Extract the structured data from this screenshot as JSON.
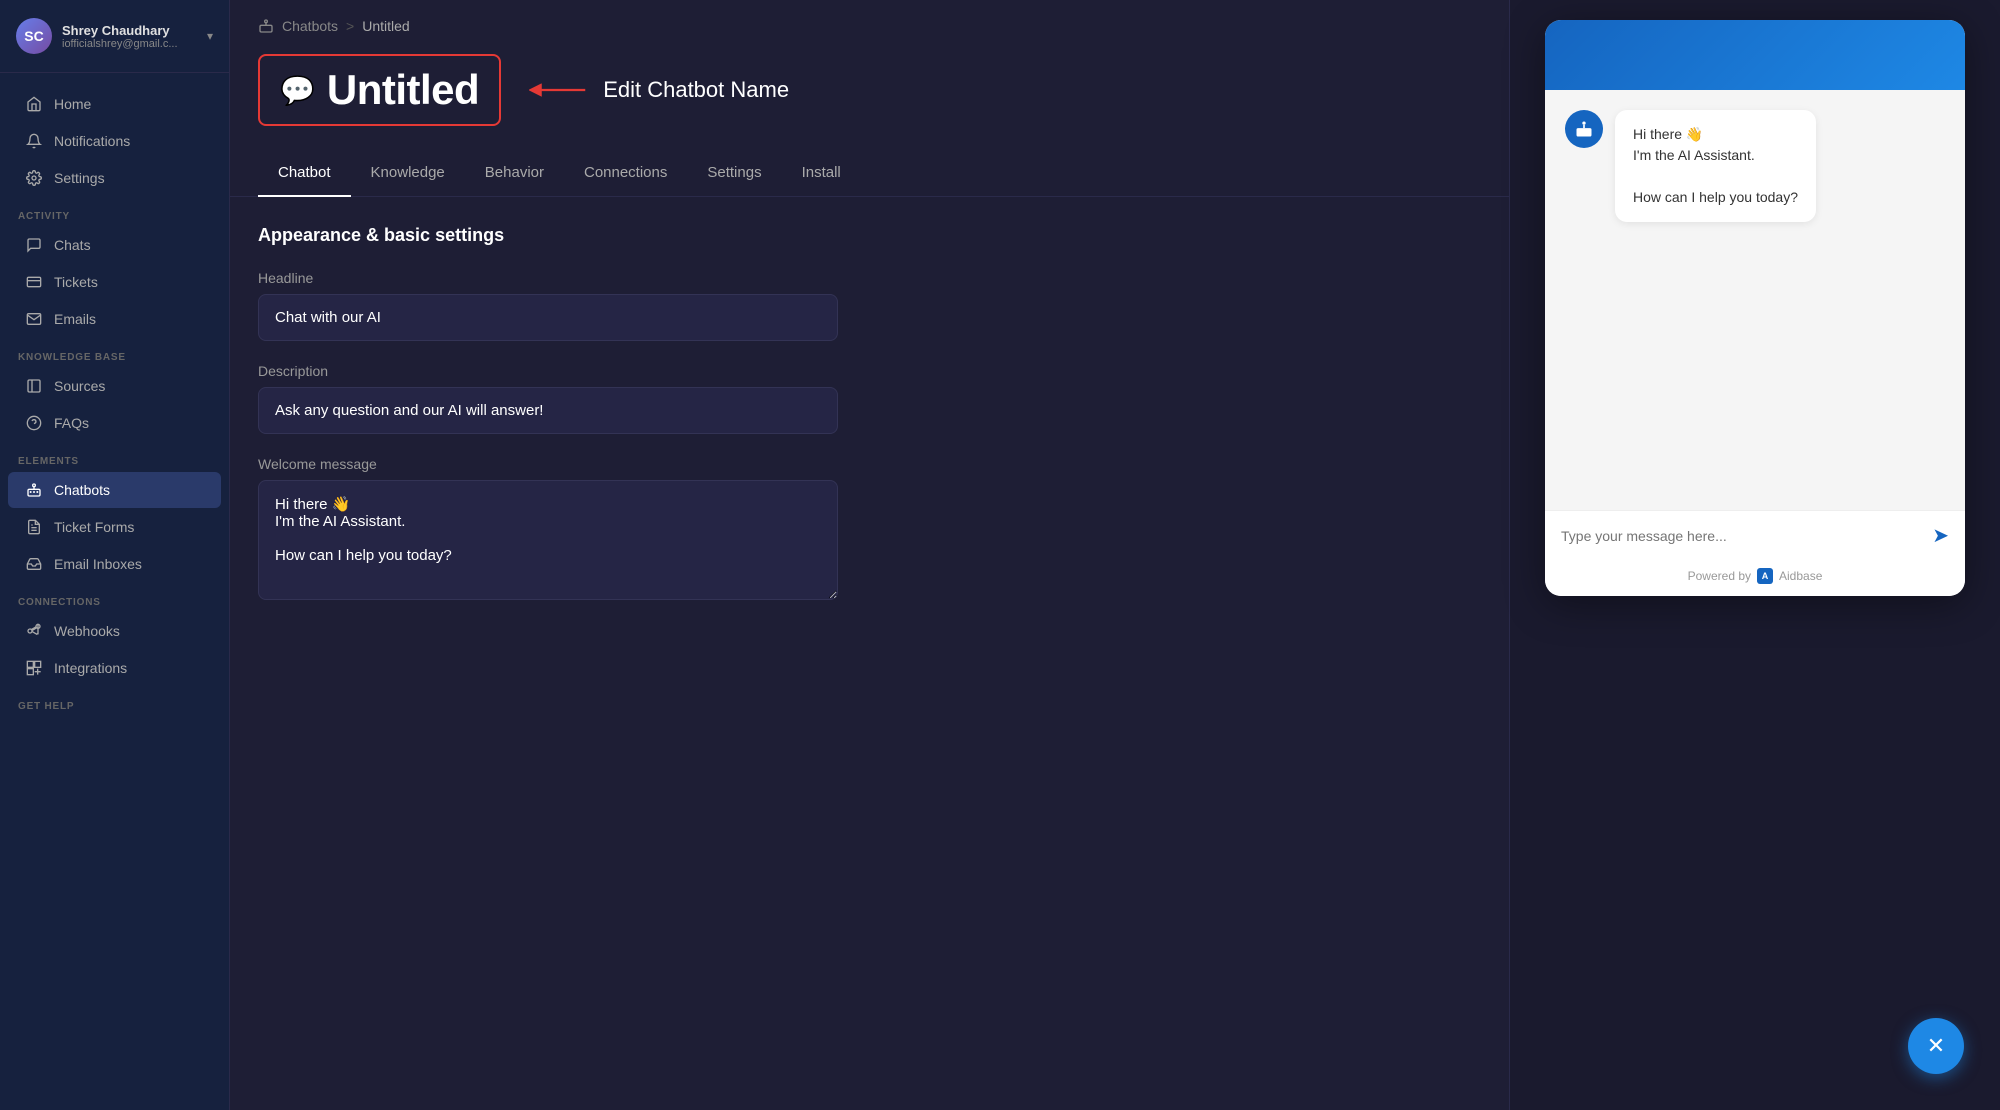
{
  "user": {
    "name": "Shrey Chaudhary",
    "email": "iofficialshrey@gmail.c...",
    "avatar_initials": "SC"
  },
  "sidebar": {
    "nav_items": [
      {
        "id": "home",
        "label": "Home",
        "icon": "home-icon"
      },
      {
        "id": "notifications",
        "label": "Notifications",
        "icon": "bell-icon"
      },
      {
        "id": "settings",
        "label": "Settings",
        "icon": "gear-icon"
      }
    ],
    "sections": [
      {
        "label": "ACTIVITY",
        "items": [
          {
            "id": "chats",
            "label": "Chats",
            "icon": "chat-icon"
          },
          {
            "id": "tickets",
            "label": "Tickets",
            "icon": "ticket-icon"
          },
          {
            "id": "emails",
            "label": "Emails",
            "icon": "email-icon"
          }
        ]
      },
      {
        "label": "KNOWLEDGE BASE",
        "items": [
          {
            "id": "sources",
            "label": "Sources",
            "icon": "sources-icon"
          },
          {
            "id": "faqs",
            "label": "FAQs",
            "icon": "faqs-icon"
          }
        ]
      },
      {
        "label": "ELEMENTS",
        "items": [
          {
            "id": "chatbots",
            "label": "Chatbots",
            "icon": "chatbot-icon",
            "active": true
          },
          {
            "id": "ticket-forms",
            "label": "Ticket Forms",
            "icon": "form-icon"
          },
          {
            "id": "email-inboxes",
            "label": "Email Inboxes",
            "icon": "inbox-icon"
          }
        ]
      },
      {
        "label": "CONNECTIONS",
        "items": [
          {
            "id": "webhooks",
            "label": "Webhooks",
            "icon": "webhook-icon"
          },
          {
            "id": "integrations",
            "label": "Integrations",
            "icon": "integrations-icon"
          }
        ]
      },
      {
        "label": "GET HELP",
        "items": []
      }
    ]
  },
  "breadcrumb": {
    "parent": "Chatbots",
    "separator": ">",
    "current": "Untitled"
  },
  "chatbot": {
    "name": "Untitled",
    "edit_label": "Edit Chatbot Name"
  },
  "tabs": [
    {
      "id": "chatbot",
      "label": "Chatbot",
      "active": true
    },
    {
      "id": "knowledge",
      "label": "Knowledge"
    },
    {
      "id": "behavior",
      "label": "Behavior"
    },
    {
      "id": "connections",
      "label": "Connections"
    },
    {
      "id": "settings",
      "label": "Settings"
    },
    {
      "id": "install",
      "label": "Install"
    }
  ],
  "form": {
    "section_title": "Appearance & basic settings",
    "fields": [
      {
        "id": "headline",
        "label": "Headline",
        "type": "input",
        "value": "Chat with our AI",
        "placeholder": "Chat with our AI"
      },
      {
        "id": "description",
        "label": "Description",
        "type": "input",
        "value": "Ask any question and our AI will answer!",
        "placeholder": "Ask any question and our AI will answer!"
      },
      {
        "id": "welcome_message",
        "label": "Welcome message",
        "type": "textarea",
        "value": "Hi there 👋\nI'm the AI Assistant.\n\nHow can I help you today?",
        "placeholder": ""
      }
    ]
  },
  "chat_preview": {
    "header_bg": "#1565c0",
    "bot_message": "Hi there 👋\nI'm the AI Assistant.\nHow can I help you today?",
    "input_placeholder": "Type your message here...",
    "powered_by": "Powered by",
    "brand": "Aidbase",
    "send_icon": "➤"
  },
  "fab": {
    "icon": "✕",
    "bg": "#1e88e5"
  }
}
